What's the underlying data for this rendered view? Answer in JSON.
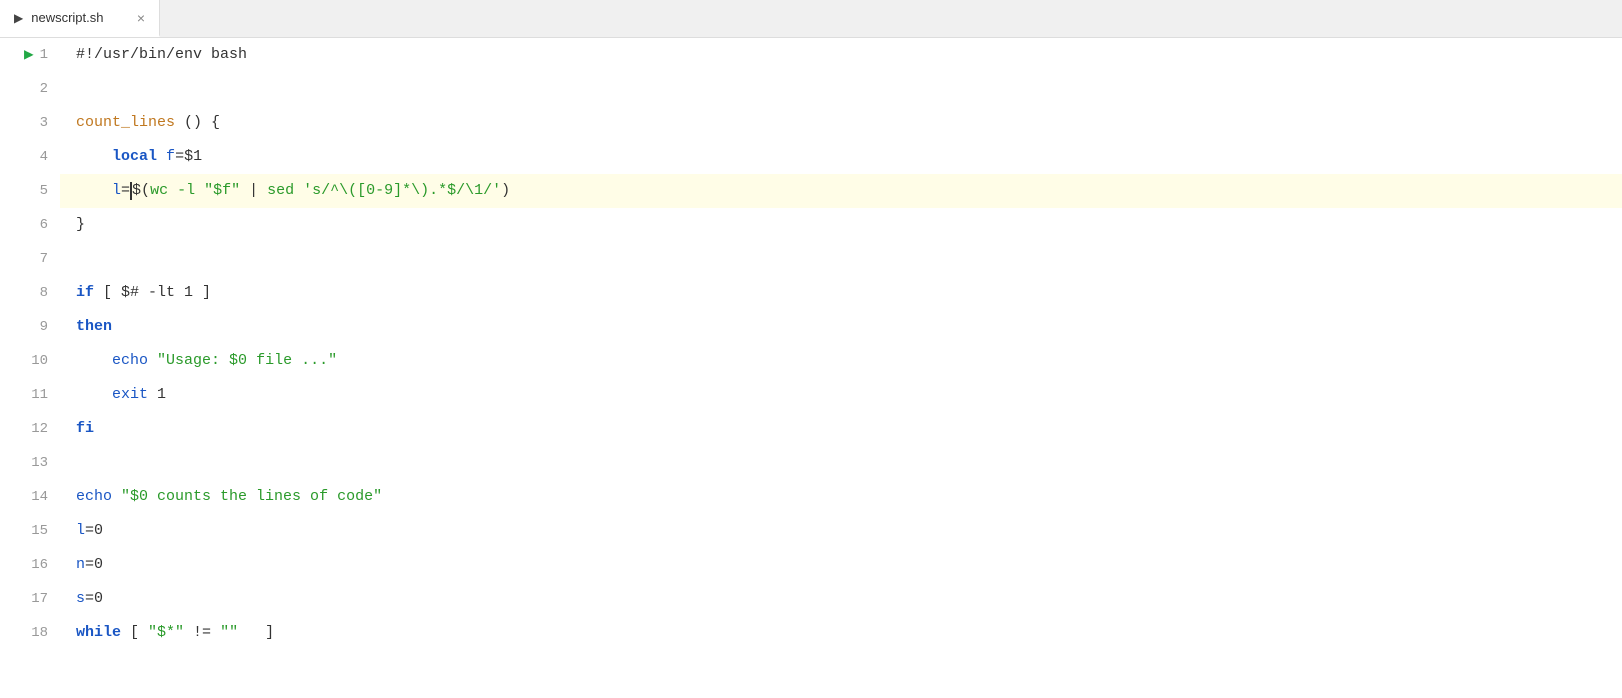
{
  "tab": {
    "icon": "▶",
    "filename": "newscript.sh",
    "close": "×"
  },
  "lines": [
    {
      "num": 1,
      "has_arrow": true,
      "content": "shebang"
    },
    {
      "num": 2,
      "has_arrow": false,
      "content": "empty"
    },
    {
      "num": 3,
      "has_arrow": false,
      "content": "func_def"
    },
    {
      "num": 4,
      "has_arrow": false,
      "content": "local_f"
    },
    {
      "num": 5,
      "has_arrow": false,
      "content": "l_assign",
      "highlighted": true
    },
    {
      "num": 6,
      "has_arrow": false,
      "content": "close_brace"
    },
    {
      "num": 7,
      "has_arrow": false,
      "content": "empty"
    },
    {
      "num": 8,
      "has_arrow": false,
      "content": "if_stmt"
    },
    {
      "num": 9,
      "has_arrow": false,
      "content": "then_stmt"
    },
    {
      "num": 10,
      "has_arrow": false,
      "content": "echo_usage"
    },
    {
      "num": 11,
      "has_arrow": false,
      "content": "exit_1"
    },
    {
      "num": 12,
      "has_arrow": false,
      "content": "fi_stmt"
    },
    {
      "num": 13,
      "has_arrow": false,
      "content": "empty"
    },
    {
      "num": 14,
      "has_arrow": false,
      "content": "echo_counts"
    },
    {
      "num": 15,
      "has_arrow": false,
      "content": "l_zero"
    },
    {
      "num": 16,
      "has_arrow": false,
      "content": "n_zero"
    },
    {
      "num": 17,
      "has_arrow": false,
      "content": "s_zero"
    },
    {
      "num": 18,
      "has_arrow": false,
      "content": "while_stmt"
    }
  ]
}
